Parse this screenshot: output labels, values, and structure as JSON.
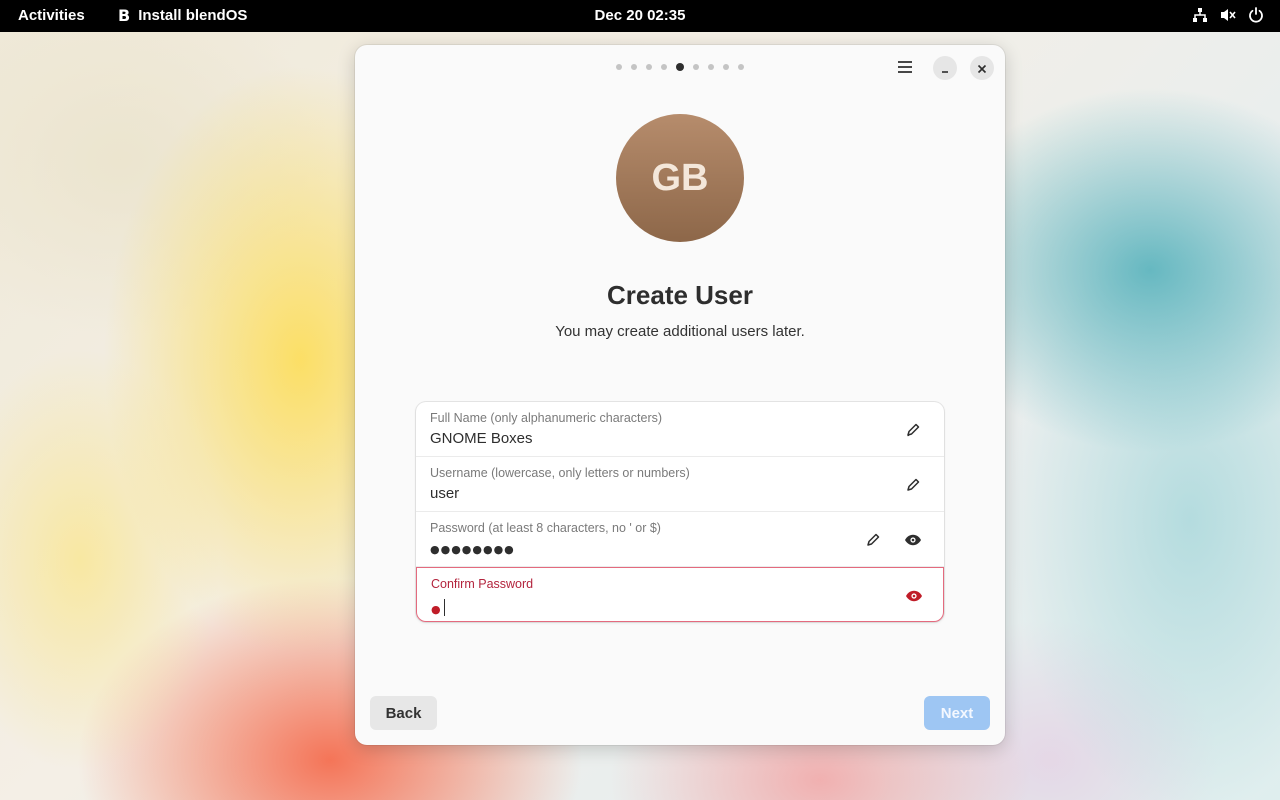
{
  "topbar": {
    "activities": "Activities",
    "app_logo": "B",
    "app_name": "Install blendOS",
    "clock": "Dec 20  02:35",
    "tray_icons": [
      "network-icon",
      "volume-muted-icon",
      "power-icon"
    ]
  },
  "window": {
    "pager": {
      "total": 9,
      "active_index": 4
    },
    "avatar_initials": "GB",
    "title": "Create User",
    "subtitle": "You may create additional users later.",
    "fields": {
      "full_name": {
        "label": "Full Name (only alphanumeric characters)",
        "value": "GNOME Boxes"
      },
      "username": {
        "label": "Username (lowercase, only letters or numbers)",
        "value": "user"
      },
      "password": {
        "label": "Password (at least 8 characters, no ' or $)",
        "value": "●●●●●●●●"
      },
      "confirm_password": {
        "label": "Confirm Password",
        "value": "●"
      }
    },
    "buttons": {
      "back": "Back",
      "next": "Next"
    }
  },
  "colors": {
    "accent_disabled": "#9ec6f3",
    "error": "#c01c28",
    "error_border": "#e46a7e",
    "avatar": "#a57c5d"
  }
}
